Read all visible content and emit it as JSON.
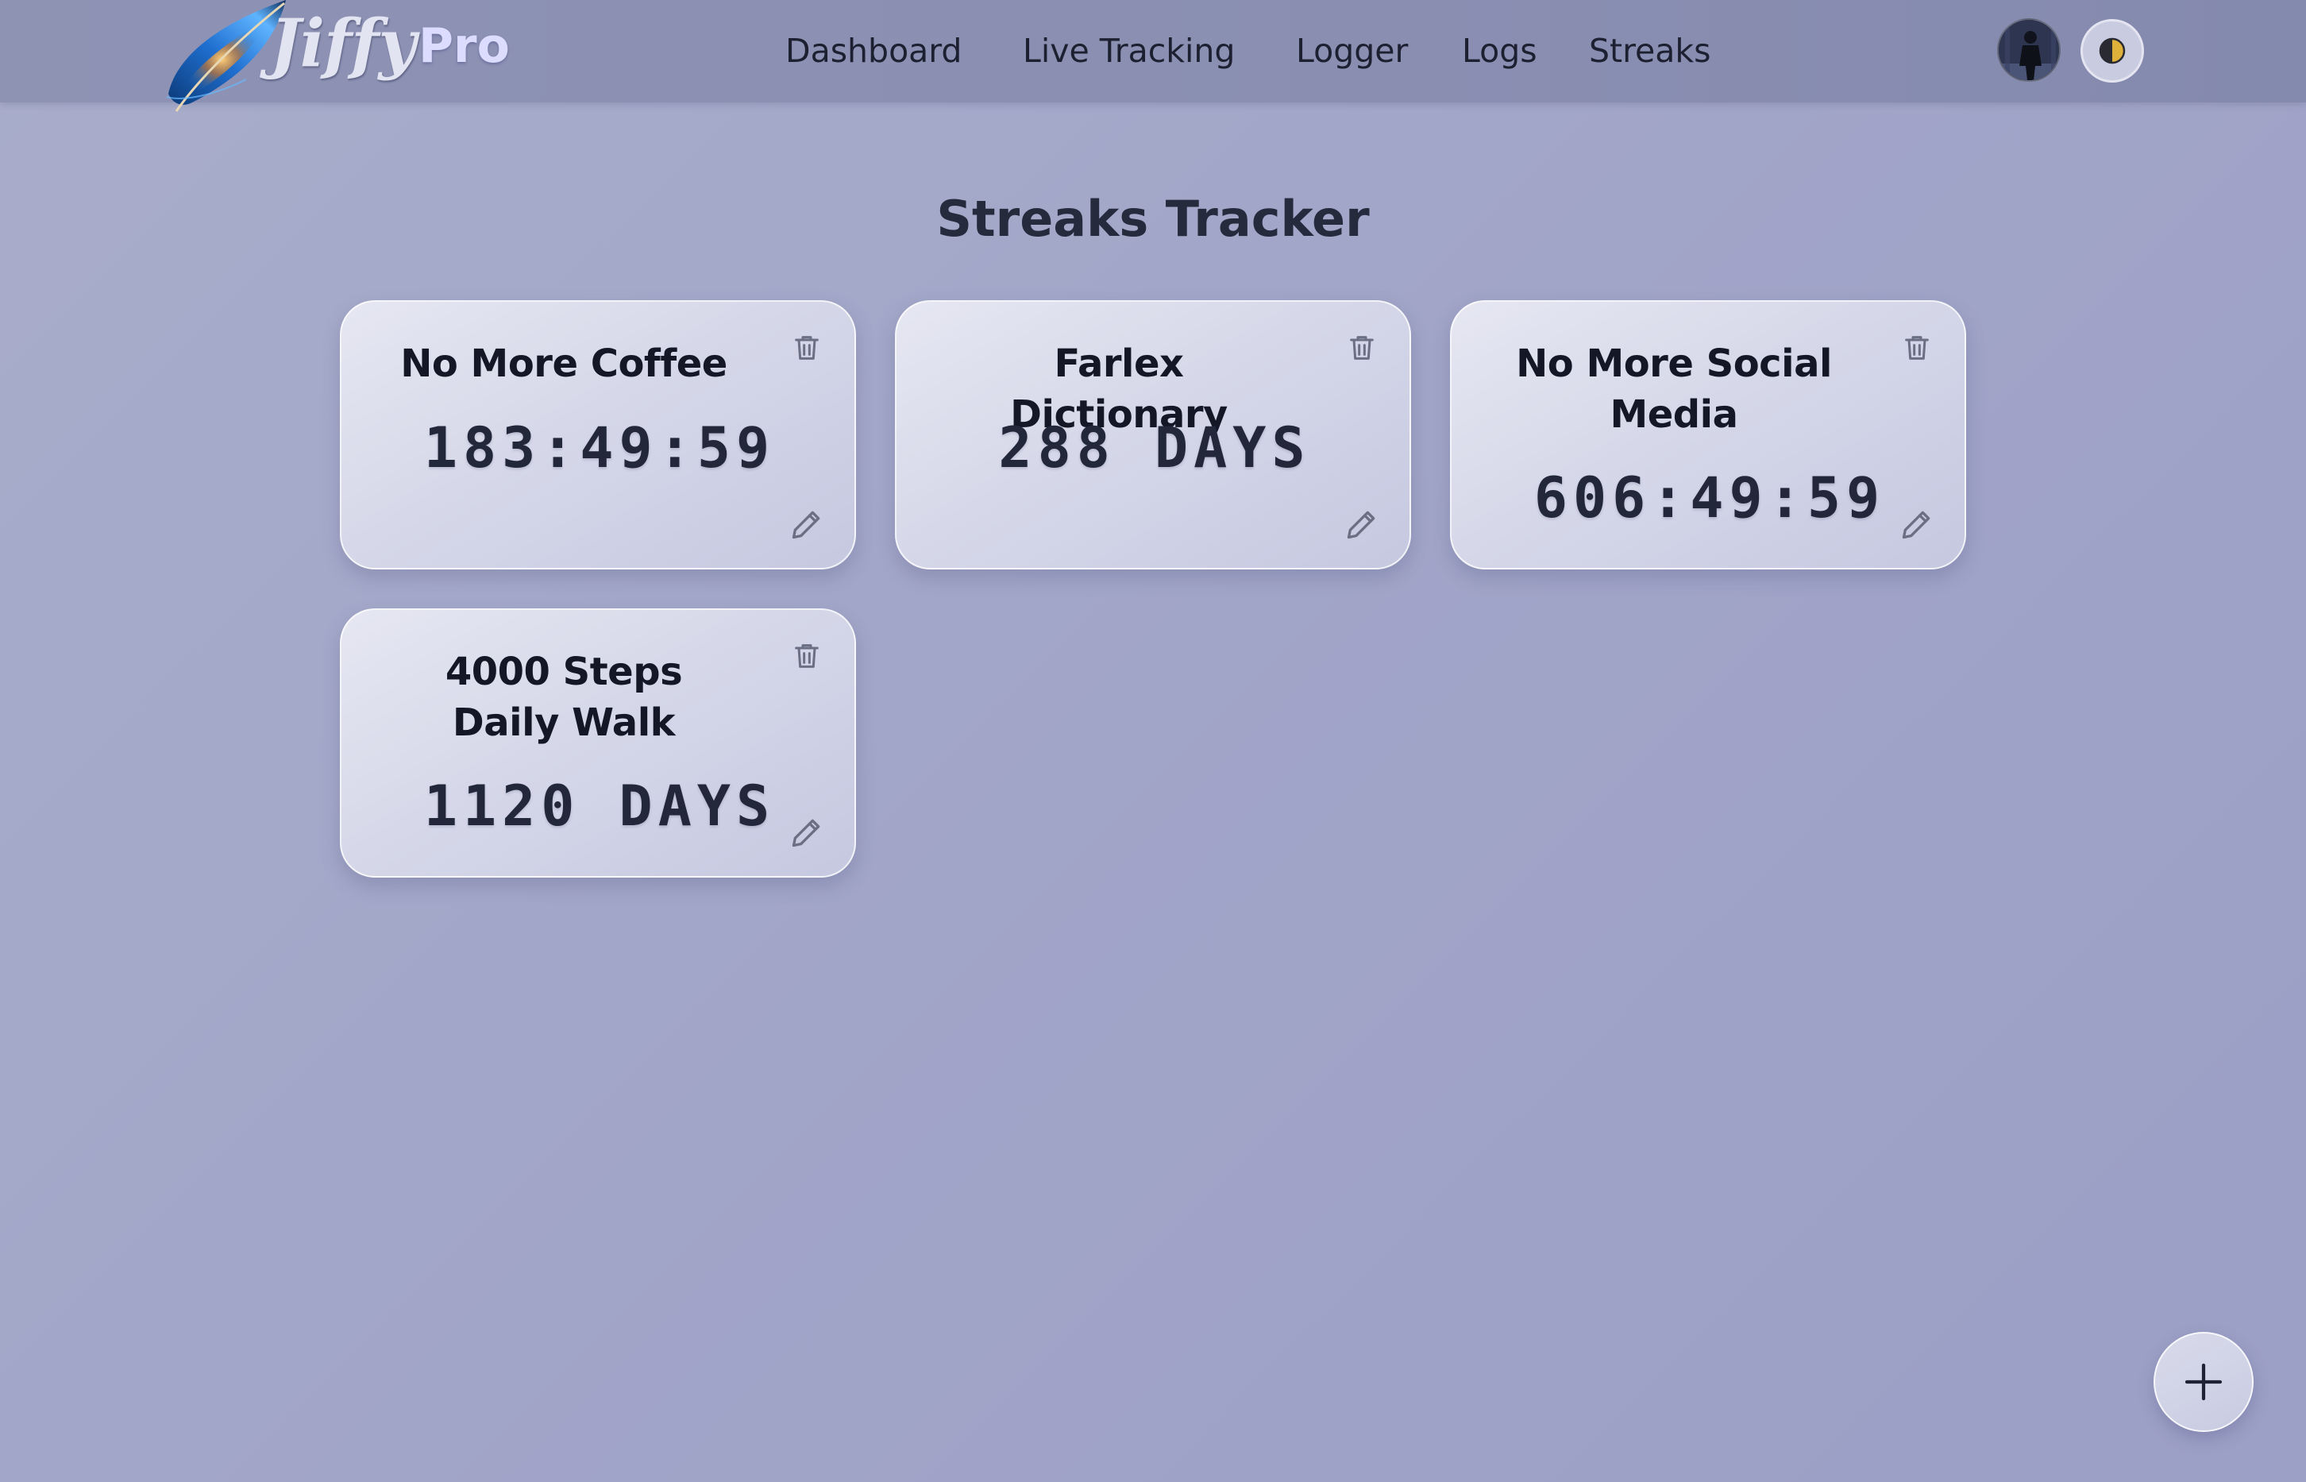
{
  "brand": {
    "logo_text": "Jiffy",
    "badge": "Pro"
  },
  "nav": {
    "items": [
      {
        "label": "Dashboard"
      },
      {
        "label": "Live Tracking"
      },
      {
        "label": "Logger"
      },
      {
        "label": "Logs"
      },
      {
        "label": "Streaks"
      }
    ]
  },
  "header": {
    "avatar_icon": "user-avatar",
    "theme_icon": "half-moon-icon"
  },
  "page": {
    "title": "Streaks Tracker"
  },
  "streaks": [
    {
      "title": "No More Coffee",
      "value": "183:49:59"
    },
    {
      "title": "Farlex Dictionary",
      "value": "288 DAYS"
    },
    {
      "title": "No More Social Media",
      "value": "606:49:59"
    },
    {
      "title": "4000 Steps Daily Walk",
      "value": "1120 DAYS"
    }
  ],
  "icons": {
    "delete": "trash-icon",
    "edit": "pencil-icon",
    "add": "plus-icon"
  },
  "colors": {
    "background": "#a3a7c8",
    "header": "#8a8fb2",
    "card": "#d6d8e9",
    "text": "#1e2235",
    "pro_badge": "#dcdcff",
    "theme_toggle_accent": "#e0b13a"
  }
}
